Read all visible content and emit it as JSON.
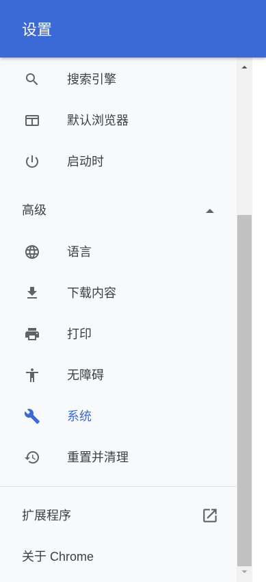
{
  "header": {
    "title": "设置"
  },
  "menu": {
    "items": [
      {
        "label": "搜索引擎",
        "icon": "search-icon"
      },
      {
        "label": "默认浏览器",
        "icon": "browser-window-icon"
      },
      {
        "label": "启动时",
        "icon": "power-icon"
      }
    ],
    "advanced": {
      "label": "高级",
      "caret_icon": "caret-up-icon",
      "items": [
        {
          "label": "语言",
          "icon": "globe-icon"
        },
        {
          "label": "下载内容",
          "icon": "download-icon"
        },
        {
          "label": "打印",
          "icon": "printer-icon"
        },
        {
          "label": "无障碍",
          "icon": "accessibility-icon"
        },
        {
          "label": "系统",
          "icon": "wrench-icon",
          "active": true
        },
        {
          "label": "重置并清理",
          "icon": "restore-icon"
        }
      ]
    }
  },
  "footer": {
    "extensions_label": "扩展程序",
    "extensions_icon": "open-in-new-icon",
    "about_label": "关于 Chrome"
  },
  "colors": {
    "header_bg": "#3b69d6",
    "accent": "#3b69d6",
    "text": "#3c4043",
    "icon": "#5f6368",
    "background": "#f8f9fa"
  }
}
